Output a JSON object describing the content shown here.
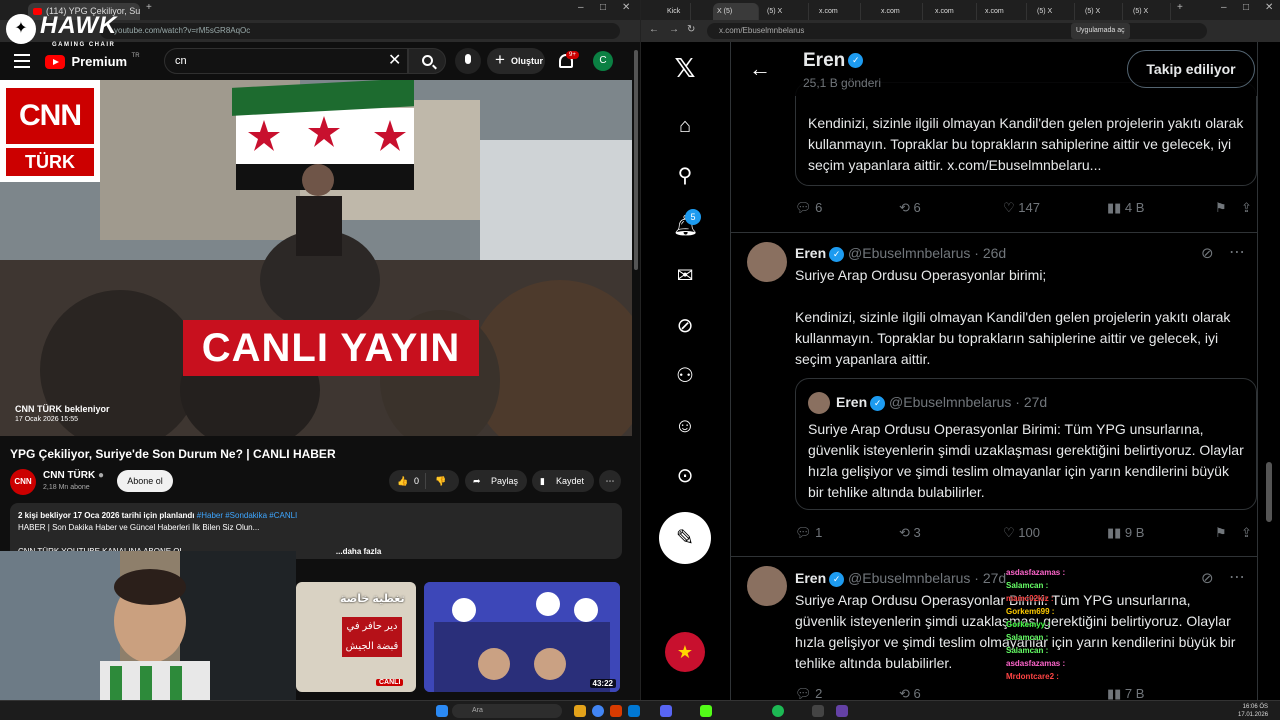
{
  "left_browser": {
    "tab_title": "(114) YPG Çekiliyor, Suriye'de S",
    "url": "youtube.com/watch?v=rM5sGR8AqOc"
  },
  "hawk": {
    "title": "HAWK",
    "subtitle": "GAMING CHAIR"
  },
  "youtube": {
    "logo_text": "Premium",
    "logo_region": "TR",
    "search_value": "cn",
    "create_label": "Oluştur",
    "notif_count": "9+",
    "avatar_letter": "C",
    "player": {
      "cnn_top": "CNN",
      "cnn_bottom": "TÜRK",
      "live_banner": "CANLI YAYIN",
      "waiting_label": "CNN TÜRK bekleniyor",
      "waiting_date": "17 Ocak 2026 15:55"
    },
    "video_title": "YPG Çekiliyor, Suriye'de Son Durum Ne? | CANLI HABER",
    "channel_name": "CNN TÜRK",
    "channel_avatar_text": "CNN",
    "subscribers": "2,18 Mn abone",
    "subscribe_label": "Abone ol",
    "like_count": "0",
    "share_label": "Paylaş",
    "save_label": "Kaydet",
    "desc_line1": "2 kişi bekliyor  17 Oca 2026 tarihi için planlandı",
    "desc_tags": "#Haber #Sondakika #CANLI",
    "desc_line2": "HABER | Son Dakika Haber ve Güncel Haberleri İlk Bilen Siz Olun...",
    "desc_line3": "CNN TÜRK YOUTUBE KANALINA ABONE OL",
    "desc_more": "...daha fazla",
    "thumb1_top": "تغطية خاصة",
    "thumb1_mid": "دير حافر في قبضة الجيش",
    "thumb1_live": "CANLI",
    "thumb2_duration": "43:22"
  },
  "right_browser": {
    "tabs": [
      "Kick",
      "X (5)",
      "(5) X",
      "x.com",
      "x.com",
      "x.com",
      "x.com",
      "(5) X",
      "(5) X",
      "(5) X"
    ],
    "url": "x.com/Ebuselmnbelarus",
    "apps_label": "Uygulamada aç"
  },
  "x": {
    "notif_badge": "5",
    "header_name": "Eren",
    "header_posts": "25,1 B gönderi",
    "follow_label": "Takip ediliyor",
    "post1": {
      "text": "Kendinizi, sizinle ilgili olmayan Kandil'den gelen projelerin yakıtı olarak kullanmayın. Topraklar bu toprakların sahiplerine aittir ve gelecek, iyi seçim yapanlara aittir. x.com/Ebuselmnbelaru...",
      "replies": "6",
      "reposts": "6",
      "likes": "147",
      "views": "4 B"
    },
    "post2": {
      "name": "Eren",
      "handle": "@Ebuselmnbelarus",
      "time": "· 26d",
      "line1": "Suriye Arap Ordusu Operasyonlar birimi;",
      "body": "Kendinizi, sizinle ilgili olmayan Kandil'den gelen projelerin yakıtı olarak kullanmayın. Topraklar bu toprakların sahiplerine aittir ve gelecek, iyi seçim yapanlara aittir.",
      "quote": {
        "name": "Eren",
        "handle": "@Ebuselmnbelarus",
        "time": "· 27d",
        "text": "Suriye Arap Ordusu Operasyonlar Birimi: Tüm YPG unsurlarına, güvenlik isteyenlerin şimdi uzaklaşması gerektiğini belirtiyoruz. Olaylar hızla gelişiyor ve şimdi teslim olmayanlar için yarın kendilerini büyük bir tehlike altında bulabilirler."
      },
      "replies": "1",
      "reposts": "3",
      "likes": "100",
      "views": "9 B"
    },
    "post3": {
      "name": "Eren",
      "handle": "@Ebuselmnbelarus",
      "time": "· 27d",
      "text": "Suriye Arap Ordusu Operasyonlar Birimi: Tüm YPG unsurlarına, güvenlik isteyenlerin şimdi uzaklaşması gerektiğini belirtiyoruz. Olaylar hızla gelişiyor ve şimdi teslim olmayanlar için yarın kendilerini büyük bir tehlike altında bulabilirler.",
      "replies": "2",
      "reposts": "6",
      "views": "7 B"
    }
  },
  "chat": [
    {
      "user": "asdasfazamas :",
      "color": "#ff66cc"
    },
    {
      "user": "Salamcan :",
      "color": "#66ff66"
    },
    {
      "user": "mamc02kiz :",
      "color": "#ff4444"
    },
    {
      "user": "Gorkem699 :",
      "color": "#ffcc00"
    },
    {
      "user": "Gorkemyy :",
      "color": "#44ff44"
    },
    {
      "user": "Salamcan :",
      "color": "#66ff66"
    },
    {
      "user": "Salamcan :",
      "color": "#66ff66"
    },
    {
      "user": "asdasfazamas :",
      "color": "#ff66cc"
    },
    {
      "user": "Mrdontcare2 :",
      "color": "#ff4444"
    }
  ],
  "taskbar": {
    "search_placeholder": "Ara",
    "time": "16:06 ÖS",
    "date": "17.01.2026"
  }
}
